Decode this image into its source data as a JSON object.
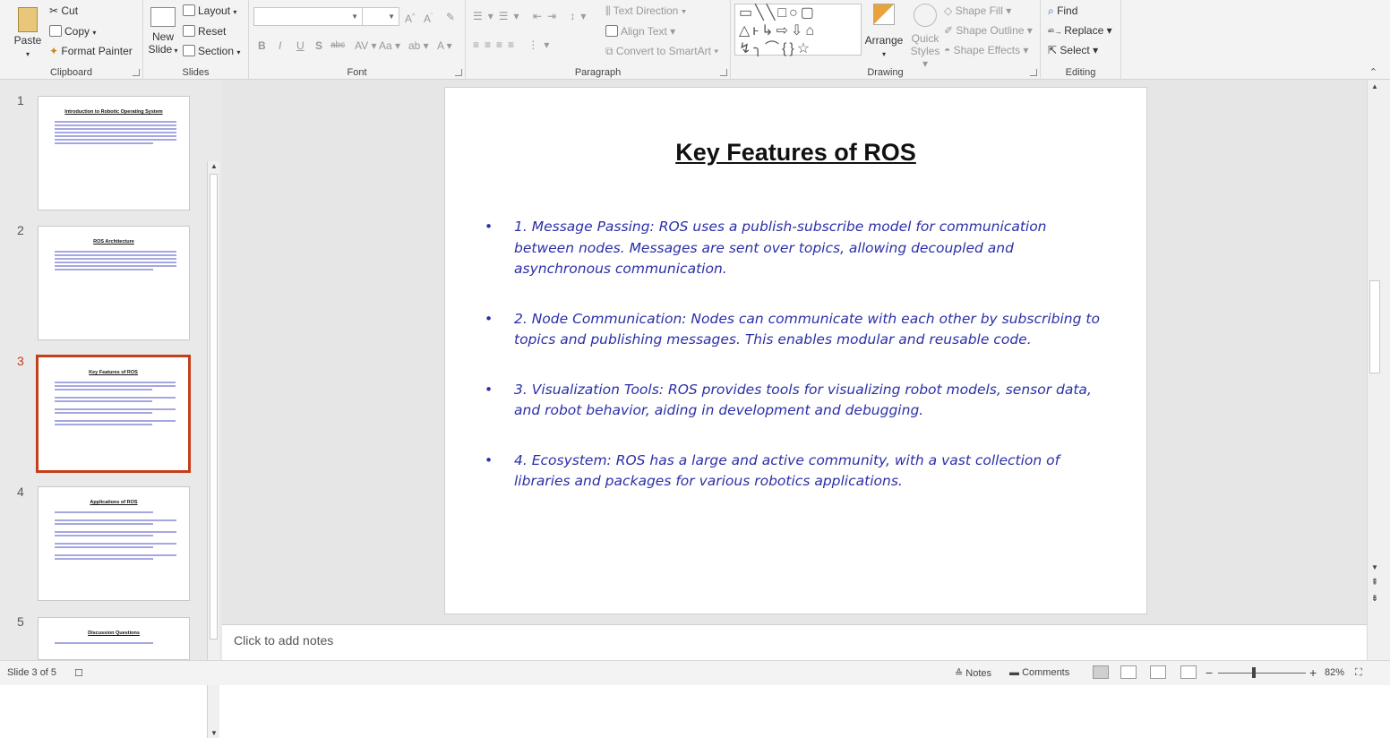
{
  "ribbon": {
    "clipboard": {
      "label": "Clipboard",
      "paste": "Paste",
      "cut": "Cut",
      "copy": "Copy",
      "format_painter": "Format Painter"
    },
    "slides": {
      "label": "Slides",
      "new_slide_line1": "New",
      "new_slide_line2": "Slide",
      "layout": "Layout",
      "reset": "Reset",
      "section": "Section"
    },
    "font": {
      "label": "Font",
      "bold": "B",
      "italic": "I",
      "underline": "U",
      "strike": "S",
      "abc": "abc",
      "spacing": "AV",
      "case": "Aa"
    },
    "paragraph": {
      "label": "Paragraph",
      "text_direction": "Text Direction",
      "align_text": "Align Text",
      "convert_smartart": "Convert to SmartArt"
    },
    "drawing": {
      "label": "Drawing",
      "arrange": "Arrange",
      "quick_styles_1": "Quick",
      "quick_styles_2": "Styles",
      "shape_fill": "Shape Fill",
      "shape_outline": "Shape Outline",
      "shape_effects": "Shape Effects"
    },
    "editing": {
      "label": "Editing",
      "find": "Find",
      "replace": "Replace",
      "select": "Select"
    }
  },
  "thumbnails": [
    {
      "number": "1",
      "title": "Introduction to Robotic Operating System"
    },
    {
      "number": "2",
      "title": "ROS Architecture"
    },
    {
      "number": "3",
      "title": "Key Features of ROS"
    },
    {
      "number": "4",
      "title": "Applications of ROS"
    },
    {
      "number": "5",
      "title": "Discussion Questions"
    }
  ],
  "slide": {
    "title": "Key Features of ROS",
    "bullets": [
      "1. Message Passing: ROS uses a publish-subscribe model for communication between nodes. Messages are sent over topics, allowing decoupled and asynchronous communication.",
      "2. Node Communication: Nodes can communicate with each other by subscribing to topics and publishing messages. This enables modular and reusable code.",
      "3. Visualization Tools: ROS provides tools for visualizing robot models, sensor data, and robot behavior, aiding in development and debugging.",
      "4. Ecosystem: ROS has a large and active community, with a vast collection of libraries and packages for various robotics applications."
    ]
  },
  "notes_placeholder": "Click to add notes",
  "status": {
    "slide_indicator": "Slide 3 of 5",
    "notes": "Notes",
    "comments": "Comments",
    "zoom": "82%"
  },
  "colors": {
    "accent": "#c43e1c",
    "bullet_text": "#2b2fa8"
  },
  "zoom_level": 0.82
}
